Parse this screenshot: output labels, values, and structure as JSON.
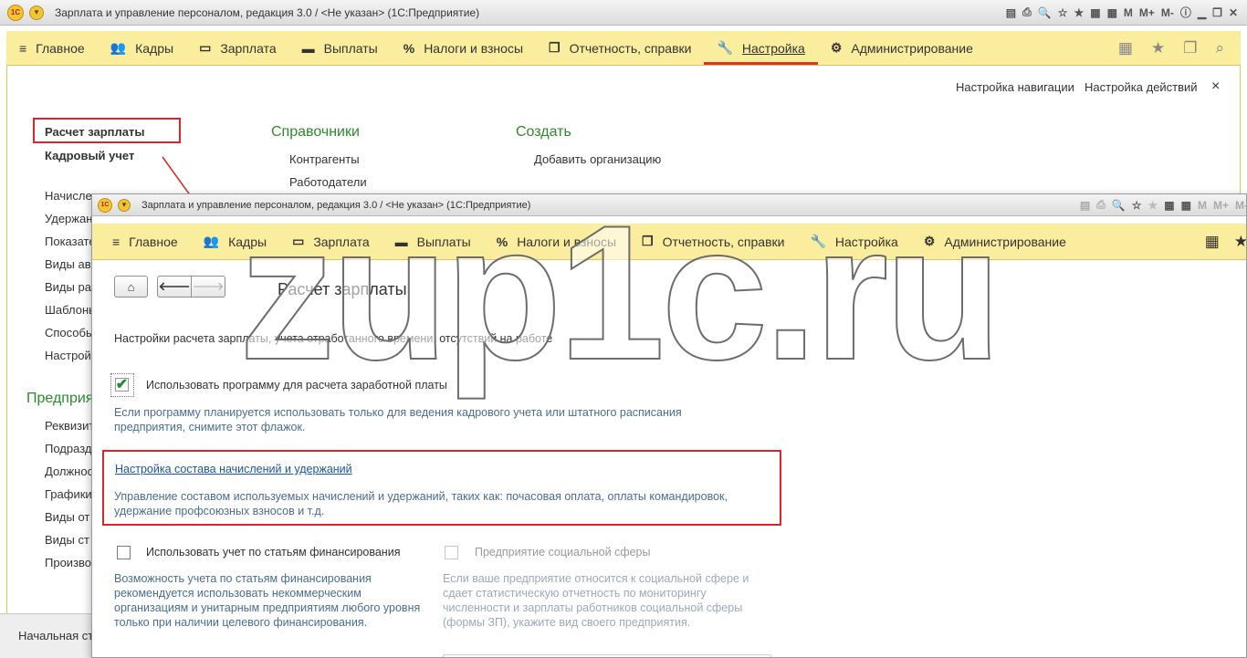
{
  "back_window": {
    "title": "Зарплата и управление персоналом, редакция 3.0 / <Не указан>  (1С:Предприятие)",
    "nav": [
      {
        "icon": "≡",
        "label": "Главное"
      },
      {
        "icon": "👥",
        "label": "Кадры"
      },
      {
        "icon": "▭",
        "label": "Зарплата"
      },
      {
        "icon": "▬",
        "label": "Выплаты"
      },
      {
        "icon": "%",
        "label": "Налоги и взносы"
      },
      {
        "icon": "❐",
        "label": "Отчетность, справки"
      },
      {
        "icon": "🔧",
        "label": "Настройка"
      },
      {
        "icon": "⚙",
        "label": "Администрирование"
      }
    ],
    "toolbar_links": {
      "nav_settings": "Настройка навигации",
      "action_settings": "Настройка действий",
      "close": "×"
    },
    "sections": {
      "payroll": "Расчет зарплаты",
      "hr": "Кадровый учет",
      "references": "Справочники",
      "create": "Создать",
      "enterprise": "Предприя"
    },
    "references_links": [
      "Контрагенты",
      "Работодатели"
    ],
    "create_links": [
      "Добавить организацию"
    ],
    "sidebar_items_top": [
      "Начисле",
      "Удержан",
      "Показате",
      "Виды ав",
      "Виды ра",
      "Шаблоны",
      "Способы",
      "Настрой"
    ],
    "sidebar_items_bottom": [
      "Реквизит",
      "Подразд",
      "Должнос",
      "Графики",
      "Виды от",
      "Виды ст",
      "Произво"
    ],
    "status": "Начальная ст"
  },
  "front_window": {
    "title": "Зарплата и управление персоналом, редакция 3.0 / <Не указан>  (1С:Предприятие)",
    "nav": [
      {
        "icon": "≡",
        "label": "Главное"
      },
      {
        "icon": "👥",
        "label": "Кадры"
      },
      {
        "icon": "▭",
        "label": "Зарплата"
      },
      {
        "icon": "▬",
        "label": "Выплаты"
      },
      {
        "icon": "%",
        "label": "Налоги и взносы"
      },
      {
        "icon": "❐",
        "label": "Отчетность, справки"
      },
      {
        "icon": "🔧",
        "label": "Настройка"
      },
      {
        "icon": "⚙",
        "label": "Администрирование"
      }
    ],
    "page_title": "Расчет зарплаты",
    "intro": "Настройки расчета зарплаты, учета отработанного времени, отсутствий на работе",
    "use_program": {
      "label": "Использовать программу для расчета заработной платы",
      "checked": true,
      "desc": "Если программу планируется использовать только для ведения кадрового учета или штатного расписания предприятия, снимите этот флажок."
    },
    "accruals_link": "Настройка состава начислений и удержаний",
    "accruals_desc": "Управление составом используемых начислений и удержаний, таких как: почасовая оплата, оплаты командировок, удержание профсоюзных взносов и т.д.",
    "financing": {
      "label": "Использовать учет по статьям финансирования",
      "checked": false,
      "desc": "Возможность учета по статьям финансирования рекомендуется использовать некоммерческим организациям и унитарным предприятиям любого уровня только при наличии целевого финансирования."
    },
    "social": {
      "label": "Предприятие социальной сферы",
      "checked": false,
      "desc": "Если ваше предприятие относится к социальной сфере и сдает статистическую отчетность по мониторингу численности и зарплаты работников социальной сферы (формы ЗП), укажите вид своего предприятия."
    }
  },
  "watermark": "zup1c.ru",
  "colors": {
    "nav_bg": "#fbed9e",
    "accent_red": "#d9262b",
    "section_green": "#2d8b2d",
    "desc_blue": "#4a6d93"
  }
}
